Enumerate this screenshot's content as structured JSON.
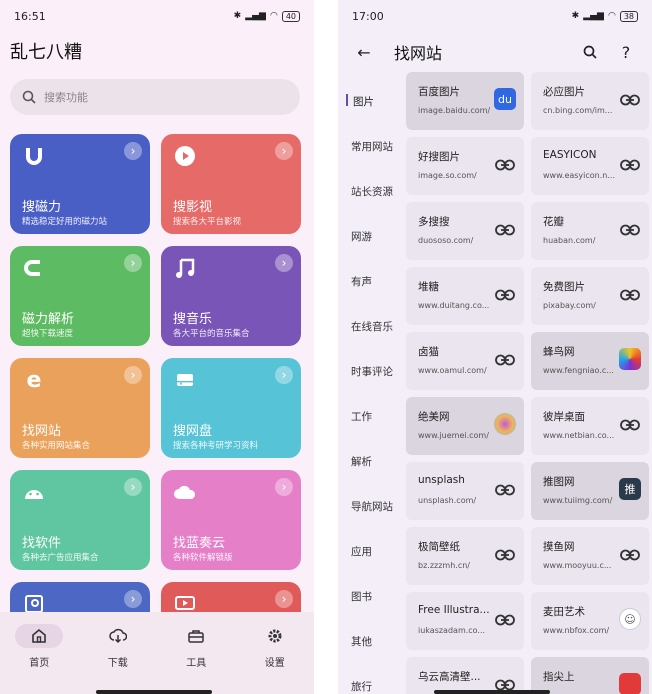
{
  "left": {
    "status": {
      "time": "16:51",
      "battery": "40"
    },
    "title": "乱七八糟",
    "search_placeholder": "搜索功能",
    "tiles": [
      {
        "name": "搜磁力",
        "desc": "精选稳定好用的磁力站",
        "icon": "magnet-u-icon",
        "color": "#4a5fc5"
      },
      {
        "name": "搜影视",
        "desc": "搜索各大平台影视",
        "icon": "play-icon",
        "color": "#e56a68"
      },
      {
        "name": "磁力解析",
        "desc": "超快下载速度",
        "icon": "magnet-icon",
        "color": "#5dbb63"
      },
      {
        "name": "搜音乐",
        "desc": "各大平台的音乐集合",
        "icon": "music-note-icon",
        "color": "#7a55b8"
      },
      {
        "name": "找网站",
        "desc": "各种实用网站集合",
        "icon": "ie-browser-icon",
        "color": "#e9a15c"
      },
      {
        "name": "搜网盘",
        "desc": "搜索各种考研学习资料",
        "icon": "drive-icon",
        "color": "#56c4d6"
      },
      {
        "name": "找软件",
        "desc": "各种去广告应用集合",
        "icon": "android-icon",
        "color": "#5fc6a1"
      },
      {
        "name": "找蓝奏云",
        "desc": "各种软件解锁版",
        "icon": "cloud-icon",
        "color": "#e57fc8"
      },
      {
        "name": "",
        "desc": "",
        "icon": "image-search-icon",
        "color": "#4c67c4"
      },
      {
        "name": "",
        "desc": "",
        "icon": "tv-icon",
        "color": "#e15a5a"
      }
    ],
    "nav": [
      {
        "label": "首页",
        "icon": "home-icon",
        "active": true
      },
      {
        "label": "下载",
        "icon": "cloud-download-icon",
        "active": false
      },
      {
        "label": "工具",
        "icon": "toolbox-icon",
        "active": false
      },
      {
        "label": "设置",
        "icon": "settings-icon",
        "active": false
      }
    ]
  },
  "right": {
    "status": {
      "time": "17:00",
      "battery": "38"
    },
    "title": "找网站",
    "categories": [
      "图片",
      "常用网站",
      "站长资源",
      "网游",
      "有声",
      "在线音乐",
      "时事评论",
      "工作",
      "解析",
      "导航网站",
      "应用",
      "图书",
      "其他",
      "旅行"
    ],
    "sites": [
      {
        "name": "百度图片",
        "url": "image.baidu.com/",
        "logo": "baidu",
        "dark": true
      },
      {
        "name": "必应图片",
        "url": "cn.bing.com/im...",
        "logo": "",
        "dark": false
      },
      {
        "name": "好搜图片",
        "url": "image.so.com/",
        "logo": "",
        "dark": false
      },
      {
        "name": "EASYICON",
        "url": "www.easyicon.n...",
        "logo": "",
        "dark": false
      },
      {
        "name": "多搜搜",
        "url": "duososo.com/",
        "logo": "",
        "dark": false
      },
      {
        "name": "花瓣",
        "url": "huaban.com/",
        "logo": "",
        "dark": false
      },
      {
        "name": "堆糖",
        "url": "www.duitang.co...",
        "logo": "",
        "dark": false
      },
      {
        "name": "免费图片",
        "url": "pixabay.com/",
        "logo": "",
        "dark": false
      },
      {
        "name": "卤猫",
        "url": "www.oamul.com/",
        "logo": "",
        "dark": false
      },
      {
        "name": "蜂鸟网",
        "url": "www.fengniao.c...",
        "logo": "fengniao",
        "dark": true
      },
      {
        "name": "绝美网",
        "url": "www.juemei.com/",
        "logo": "juemei",
        "dark": true
      },
      {
        "name": "彼岸桌面",
        "url": "www.netbian.co...",
        "logo": "",
        "dark": false
      },
      {
        "name": "unsplash",
        "url": "unsplash.com/",
        "logo": "",
        "dark": false
      },
      {
        "name": "推图网",
        "url": "www.tuiimg.com/",
        "logo": "推",
        "dark": true
      },
      {
        "name": "极简壁纸",
        "url": "bz.zzzmh.cn/",
        "logo": "",
        "dark": false
      },
      {
        "name": "摸鱼网",
        "url": "www.mooyuu.c...",
        "logo": "",
        "dark": false
      },
      {
        "name": "Free Illustra...",
        "url": "iukaszadam.co...",
        "logo": "",
        "dark": false
      },
      {
        "name": "麦田艺术",
        "url": "www.nbfox.com/",
        "logo": "maitian",
        "dark": false
      },
      {
        "name": "乌云高清壁...",
        "url": "",
        "logo": "",
        "dark": false
      },
      {
        "name": "指尖上",
        "url": "",
        "logo": "zhijian",
        "dark": true
      }
    ]
  }
}
